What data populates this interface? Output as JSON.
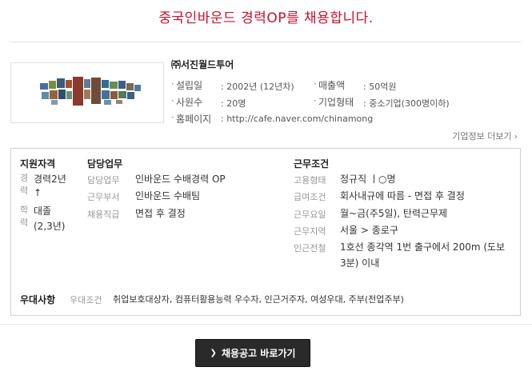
{
  "headline": "중국인바운드 경력OP를 채용합니다.",
  "company": {
    "name": "㈜서진월드투어",
    "more_link": "기업정보 더보기",
    "info": {
      "founded_label": "설립일",
      "founded_value": ": 2002년 (12년차)",
      "revenue_label": "매출액",
      "revenue_value": ": 50억원",
      "employees_label": "사원수",
      "employees_value": ": 20명",
      "type_label": "기업형태",
      "type_value": ": 중소기업(300명이하)",
      "homepage_label": "홈페이지",
      "homepage_value": ": http://cafe.naver.com/chinamong"
    }
  },
  "qualification": {
    "title": "지원자격",
    "career_label": "경력",
    "career_value": "경력2년",
    "career_value2": "↑",
    "edu_label": "학력",
    "edu_value": "대졸",
    "edu_value2": "(2,3년)"
  },
  "duty": {
    "title": "담당업무",
    "rows": [
      {
        "label": "담당업무",
        "value": "인바운드 수배경력 OP"
      },
      {
        "label": "근무부서",
        "value": "인바운드 수배팀"
      },
      {
        "label": "채용직급",
        "value": "면접 후 결정"
      }
    ]
  },
  "conditions": {
    "title": "근무조건",
    "rows": [
      {
        "label": "고용형태",
        "value": "정규직 ㅣ○명"
      },
      {
        "label": "급여조건",
        "value": "회사내규에 따름 - 면접 후 결정"
      },
      {
        "label": "근무요일",
        "value": "월~금(주5일), 탄력근무제"
      },
      {
        "label": "근무지역",
        "value": "서울 > 종로구"
      },
      {
        "label": "인근전철",
        "value": "1호선 종각역 1번 출구에서 200m (도보"
      },
      {
        "label": "",
        "value": "3분) 이내"
      }
    ]
  },
  "preferred": {
    "title": "우대사항",
    "label": "우대조건",
    "value": "취업보호대상자, 컴퓨터활용능력 우수자, 인근거주자, 여성우대, 주부(전업주부)"
  },
  "cta": {
    "label": "채용공고 바로가기"
  },
  "colors": {
    "headline": "#c8102e",
    "cta_bg": "#2a2a2a"
  }
}
